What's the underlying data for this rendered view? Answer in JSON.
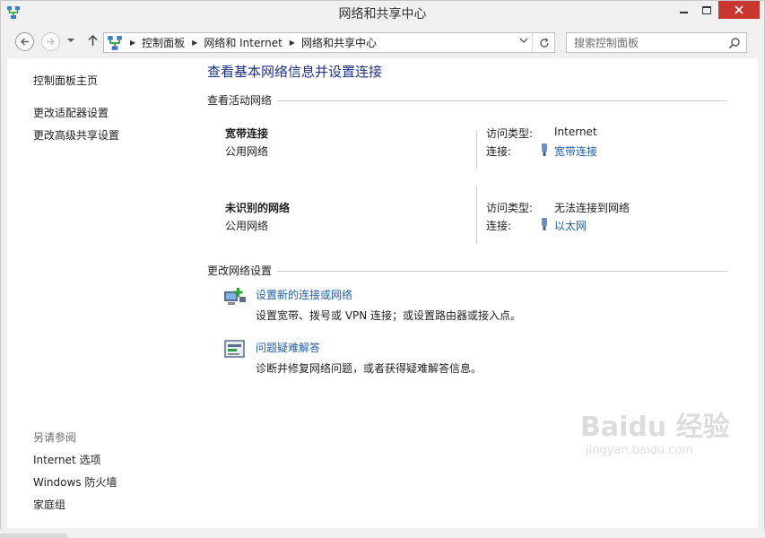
{
  "window": {
    "title": "网络和共享中心"
  },
  "address_bar": {
    "crumbs": [
      "控制面板",
      "网络和 Internet",
      "网络和共享中心"
    ]
  },
  "search": {
    "placeholder": "搜索控制面板"
  },
  "sidebar": {
    "home": "控制面板主页",
    "links": [
      "更改适配器设置",
      "更改高级共享设置"
    ],
    "see_also_label": "另请参阅",
    "see_also": [
      "Internet 选项",
      "Windows 防火墙",
      "家庭组"
    ]
  },
  "main": {
    "title": "查看基本网络信息并设置连接",
    "active_section": "查看活动网络",
    "networks": [
      {
        "name": "宽带连接",
        "type": "公用网络",
        "access_label": "访问类型:",
        "access_value": "Internet",
        "conn_label": "连接:",
        "conn_value": "宽带连接"
      },
      {
        "name": "未识别的网络",
        "type": "公用网络",
        "access_label": "访问类型:",
        "access_value": "无法连接到网络",
        "conn_label": "连接:",
        "conn_value": "以太网"
      }
    ],
    "change_section": "更改网络设置",
    "tasks": [
      {
        "link": "设置新的连接或网络",
        "desc": "设置宽带、拨号或 VPN 连接；或设置路由器或接入点。"
      },
      {
        "link": "问题疑难解答",
        "desc": "诊断并修复网络问题，或者获得疑难解答信息。"
      }
    ]
  },
  "watermark": {
    "logo": "Baidu 经验",
    "url": "jingyan.baidu.com"
  },
  "colors": {
    "link": "#1e5fa8",
    "title": "#1e3287",
    "close_button": "#c7372f"
  }
}
